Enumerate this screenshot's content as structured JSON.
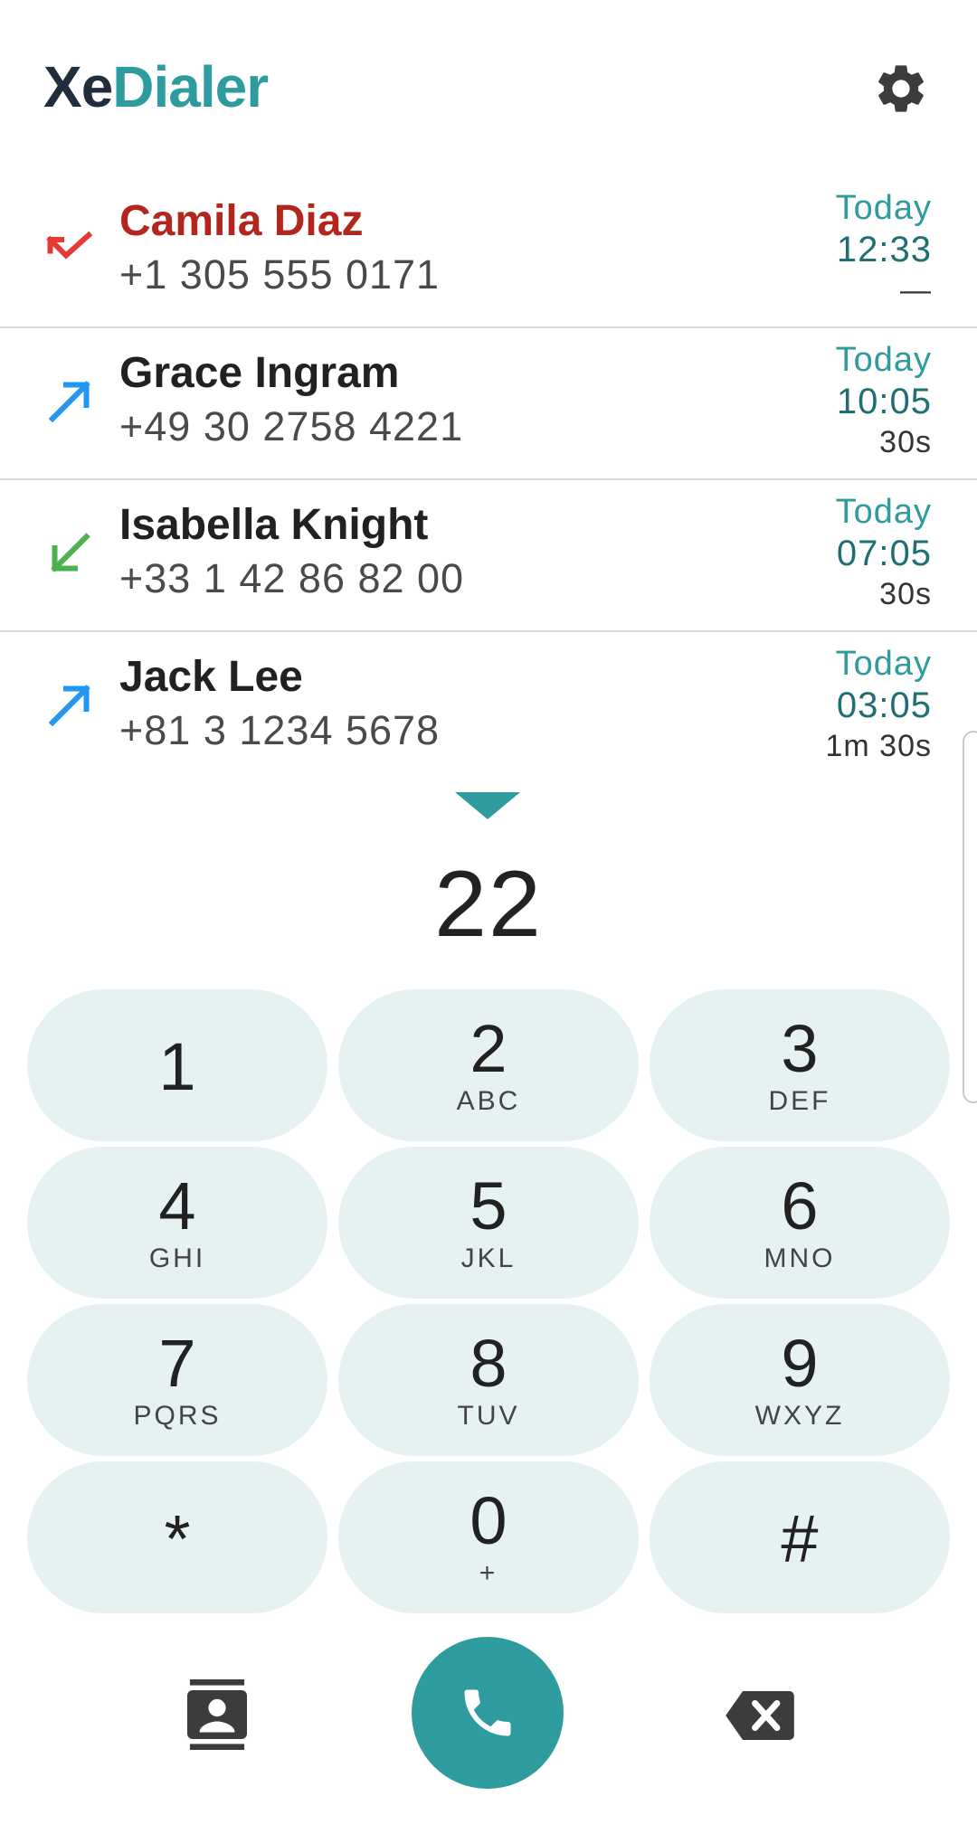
{
  "app": {
    "title_part1": "Xe",
    "title_part2": "Dialer",
    "settings_icon": "gear-icon"
  },
  "calls": [
    {
      "name": "Camila Diaz",
      "number": "+1 305 555 0171",
      "date": "Today",
      "time": "12:33",
      "duration": "—",
      "type": "missed"
    },
    {
      "name": "Grace Ingram",
      "number": "+49 30 2758 4221",
      "date": "Today",
      "time": "10:05",
      "duration": "30s",
      "type": "outgoing"
    },
    {
      "name": "Isabella Knight",
      "number": "+33 1 42 86 82 00",
      "date": "Today",
      "time": "07:05",
      "duration": "30s",
      "type": "incoming"
    },
    {
      "name": "Jack Lee",
      "number": "+81 3 1234 5678",
      "date": "Today",
      "time": "03:05",
      "duration": "1m 30s",
      "type": "outgoing"
    }
  ],
  "dialer": {
    "input": "22",
    "collapse_icon": "triangle-down-icon"
  },
  "keys": [
    {
      "digit": "1",
      "letters": ""
    },
    {
      "digit": "2",
      "letters": "ABC"
    },
    {
      "digit": "3",
      "letters": "DEF"
    },
    {
      "digit": "4",
      "letters": "GHI"
    },
    {
      "digit": "5",
      "letters": "JKL"
    },
    {
      "digit": "6",
      "letters": "MNO"
    },
    {
      "digit": "7",
      "letters": "PQRS"
    },
    {
      "digit": "8",
      "letters": "TUV"
    },
    {
      "digit": "9",
      "letters": "WXYZ"
    },
    {
      "digit": "*",
      "letters": ""
    },
    {
      "digit": "0",
      "letters": "+"
    },
    {
      "digit": "#",
      "letters": ""
    }
  ],
  "bottom": {
    "contacts_icon": "contacts-icon",
    "call_icon": "phone-icon",
    "backspace_icon": "backspace-icon"
  },
  "colors": {
    "accent": "#2e9c9f",
    "missed": "#b3261e",
    "outgoing": "#2196f3",
    "incoming": "#4caf50",
    "key_bg": "#e5f2f1"
  }
}
